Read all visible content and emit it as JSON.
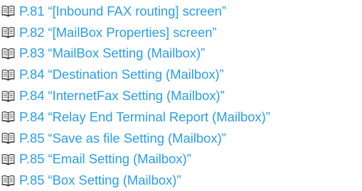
{
  "references": {
    "icon": "book-icon",
    "link_color": "#2a9ee8",
    "items": [
      {
        "page": "P.81",
        "title": "“[Inbound FAX routing] screen”"
      },
      {
        "page": "P.82",
        "title": "“[MailBox Properties] screen”"
      },
      {
        "page": "P.83",
        "title": "“MailBox Setting (Mailbox)”"
      },
      {
        "page": "P.84",
        "title": "“Destination Setting (Mailbox)”"
      },
      {
        "page": "P.84",
        "title": "“InternetFax Setting (Mailbox)”"
      },
      {
        "page": "P.84",
        "title": "“Relay End Terminal Report (Mailbox)”"
      },
      {
        "page": "P.85",
        "title": "“Save as file Setting (Mailbox)”"
      },
      {
        "page": "P.85",
        "title": "“Email Setting (Mailbox)”"
      },
      {
        "page": "P.85",
        "title": "“Box Setting (Mailbox)”"
      }
    ]
  }
}
